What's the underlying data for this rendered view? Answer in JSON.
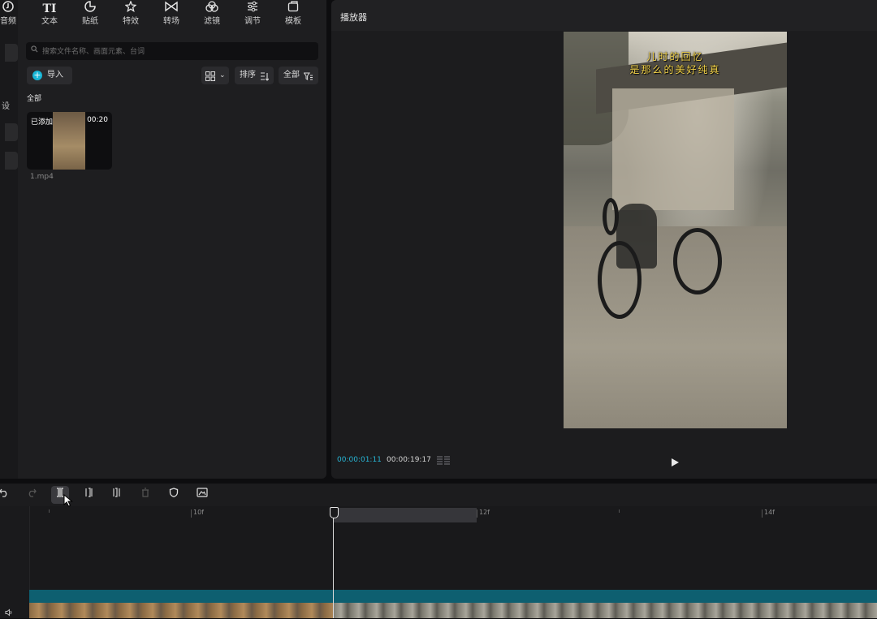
{
  "toolbar": {
    "items": [
      {
        "label": "音频",
        "icon": "audio-icon"
      },
      {
        "label": "文本",
        "icon": "text-icon",
        "glyph": "TI"
      },
      {
        "label": "贴纸",
        "icon": "sticker-icon"
      },
      {
        "label": "特效",
        "icon": "effects-icon"
      },
      {
        "label": "转场",
        "icon": "transition-icon"
      },
      {
        "label": "滤镜",
        "icon": "filter-icon"
      },
      {
        "label": "调节",
        "icon": "adjust-icon"
      },
      {
        "label": "模板",
        "icon": "template-icon"
      }
    ]
  },
  "left_strip": {
    "cut_text": "设"
  },
  "media": {
    "search_placeholder": "搜索文件名称、画面元素、台词",
    "import_label": "导入",
    "sort_label": "排序",
    "filter_label": "全部",
    "section_label": "全部",
    "clip": {
      "added_badge": "已添加",
      "duration": "00:20",
      "filename": "1.mp4"
    }
  },
  "player": {
    "title": "播放器",
    "caption_line1": "儿时的回忆",
    "caption_line2": "是那么的美好纯真",
    "time_current": "00:00:01:11",
    "time_total": "00:00:19:17"
  },
  "timeline": {
    "ruler_labels": [
      "10f",
      "12f",
      "14f"
    ]
  },
  "colors": {
    "accent": "#27b6d6",
    "track": "#0e5f70"
  }
}
